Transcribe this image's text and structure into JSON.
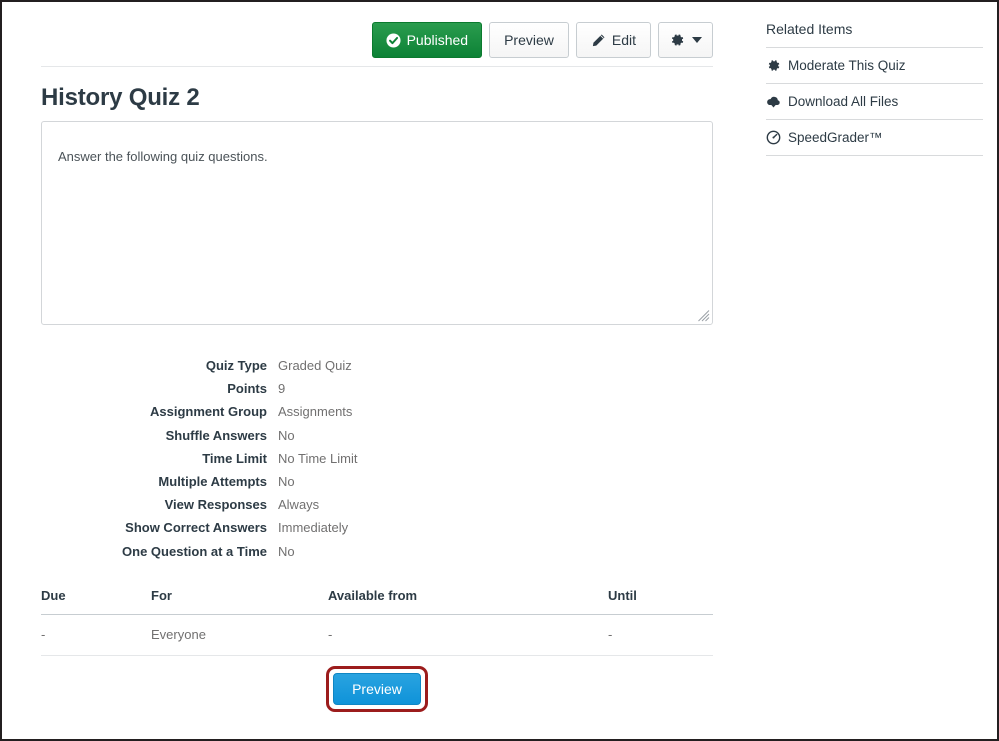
{
  "toolbar": {
    "published_label": "Published",
    "preview_label": "Preview",
    "edit_label": "Edit",
    "gear_label": ""
  },
  "quiz": {
    "title": "History Quiz 2",
    "description": "Answer the following quiz questions.",
    "details": [
      {
        "label": "Quiz Type",
        "value": "Graded Quiz"
      },
      {
        "label": "Points",
        "value": "9"
      },
      {
        "label": "Assignment Group",
        "value": "Assignments"
      },
      {
        "label": "Shuffle Answers",
        "value": "No"
      },
      {
        "label": "Time Limit",
        "value": "No Time Limit"
      },
      {
        "label": "Multiple Attempts",
        "value": "No"
      },
      {
        "label": "View Responses",
        "value": "Always"
      },
      {
        "label": "Show Correct Answers",
        "value": "Immediately"
      },
      {
        "label": "One Question at a Time",
        "value": "No"
      }
    ]
  },
  "availability": {
    "headers": [
      "Due",
      "For",
      "Available from",
      "Until"
    ],
    "rows": [
      {
        "due": "-",
        "for": "Everyone",
        "available_from": "-",
        "until": "-"
      }
    ]
  },
  "footer": {
    "preview_label": "Preview"
  },
  "sidebar": {
    "title": "Related Items",
    "items": [
      {
        "label": "Moderate This Quiz",
        "icon": "gear-icon"
      },
      {
        "label": "Download All Files",
        "icon": "download-cloud-icon"
      },
      {
        "label": "SpeedGrader™",
        "icon": "speedometer-icon"
      }
    ]
  },
  "colors": {
    "published_green": "#0d8236",
    "preview_blue": "#1c9bdd",
    "highlight_red": "#9c1c1c",
    "text_dark": "#2d3b45",
    "text_muted": "#717070",
    "border_light": "#e5e7e9"
  }
}
